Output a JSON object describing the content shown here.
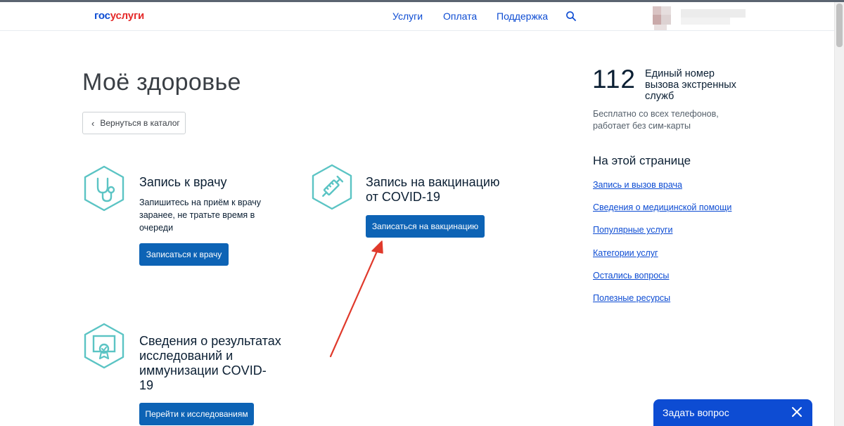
{
  "header": {
    "logo_gos": "гос",
    "logo_uslugi": "услуги",
    "nav": [
      "Услуги",
      "Оплата",
      "Поддержка"
    ]
  },
  "main": {
    "title": "Моё здоровье",
    "back_label": "Вернуться в каталог",
    "cards": [
      {
        "title": "Запись к врачу",
        "text_lines": [
          "Запишитесь на приём к врачу",
          "заранее, не тратьте время в",
          "очереди"
        ],
        "button": "Записаться к врачу",
        "icon": "stethoscope-icon"
      },
      {
        "title_lines": [
          "Запись на вакцинацию",
          "от COVID-19"
        ],
        "button": "Записаться на вакцинацию",
        "icon": "syringe-icon"
      },
      {
        "title_lines": [
          "Сведения о результатах",
          "исследований и",
          "иммунизации COVID-",
          "19"
        ],
        "button": "Перейти к исследованиям",
        "icon": "certificate-icon"
      }
    ]
  },
  "sidebar": {
    "emergency_number": "112",
    "emergency_desc_lines": [
      "Единый номер",
      "вызова экстренных",
      "служб"
    ],
    "emergency_note_lines": [
      "Бесплатно со всех телефонов,",
      "работает без сим-карты"
    ],
    "toc_title": "На этой странице",
    "toc_links": [
      "Запись и вызов врача",
      "Сведения о медицинской помощи",
      "Популярные услуги",
      "Категории услуг",
      "Остались вопросы",
      "Полезные ресурсы"
    ]
  },
  "widget": {
    "ask_label": "Задать вопрос"
  },
  "colors": {
    "brand_blue": "#0d4cd3",
    "button_blue": "#0d63b5",
    "icon_teal": "#5bc4c4",
    "annotation_arrow": "#e0392b"
  }
}
